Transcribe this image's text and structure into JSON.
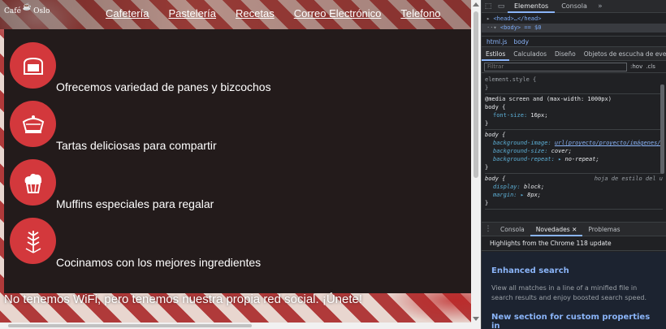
{
  "site": {
    "logo_text": "Café",
    "logo_text2": "Oslo",
    "nav": [
      "Cafetería",
      "Pastelería",
      "Recetas",
      "Correo Electrónico",
      "Telefono"
    ],
    "features": [
      {
        "icon": "bread-icon",
        "text": "Ofrecemos variedad de panes y bizcochos"
      },
      {
        "icon": "cake-icon",
        "text": "Tartas deliciosas para compartir"
      },
      {
        "icon": "muffin-icon",
        "text": "Muffins especiales para regalar"
      },
      {
        "icon": "wheat-icon",
        "text": "Cocinamos con los mejores ingredientes"
      }
    ],
    "footer": "No tenemos WiFi, pero tenemos nuestra propia red social. ¡Únete!"
  },
  "devtools": {
    "tabs": [
      "Elementos",
      "Consola"
    ],
    "dom": {
      "line1": "<head>…</head>",
      "line2": "<body> == $0"
    },
    "crumbs": [
      "html.js",
      "body"
    ],
    "subtabs": [
      "Estilos",
      "Calculados",
      "Diseño",
      "Objetos de escucha de event"
    ],
    "filter_placeholder": "Filtrar",
    "filter_hov": ":hov",
    "filter_cls": ".cls",
    "rules": {
      "element_style": "element.style {",
      "media": "@media screen and (max-width: 1000px)",
      "body1_sel": "body {",
      "body1_prop": "font-size",
      "body1_val": "16px;",
      "body2_sel": "body {",
      "body2_p1": "background-image",
      "body2_v1": "url(proyecto/proyecto/imágenes/",
      "body2_p2": "background-size",
      "body2_v2": "cover;",
      "body2_p3": "background-repeat",
      "body2_v3": "no-repeat;",
      "body3_sel": "body {",
      "body3_src": "hoja de estilo del u",
      "body3_p1": "display",
      "body3_v1": "block;",
      "body3_p2": "margin",
      "body3_v2": "8px;",
      "close": "}"
    },
    "drawer": {
      "tabs": [
        "Consola",
        "Novedades",
        "Problemas"
      ],
      "highlights": "Highlights from the Chrome 118 update",
      "news": [
        {
          "title": "Enhanced search",
          "body": "View all matches in a line of a minified file in search results and enjoy boosted search speed."
        },
        {
          "title": "New section for custom properties in"
        }
      ]
    }
  }
}
